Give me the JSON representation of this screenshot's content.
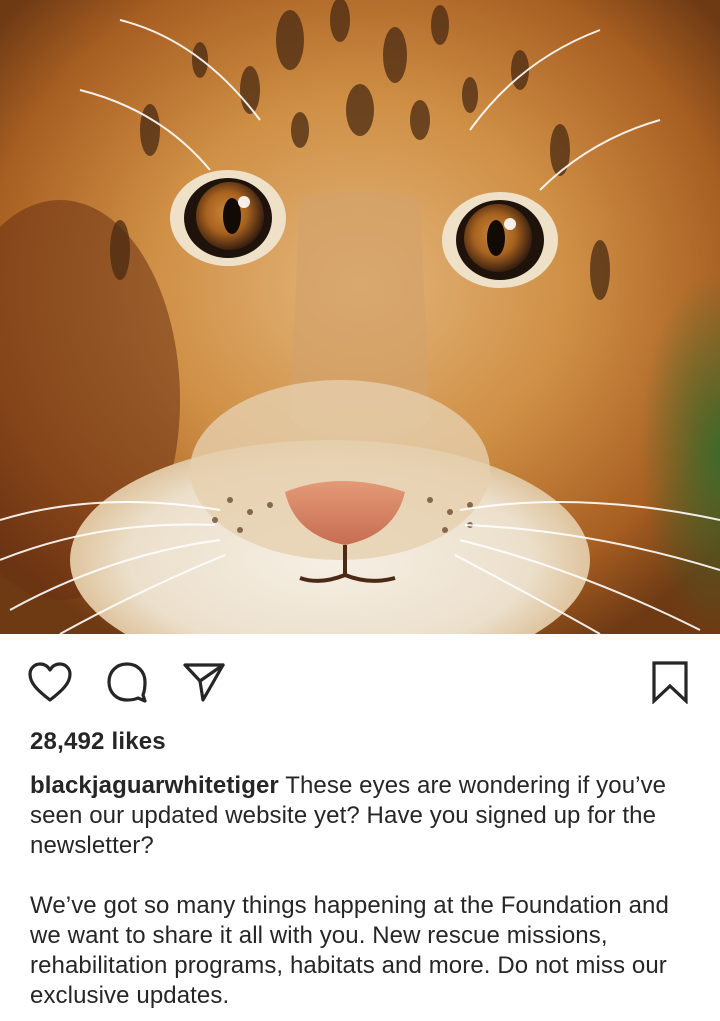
{
  "post": {
    "image_alt": "Close-up of a tiger cub's face",
    "likes_text": "28,492 likes",
    "username": "blackjaguarwhitetiger",
    "caption_first": "These eyes are wondering if you’ve seen our updated website yet? Have you signed up for the newsletter?",
    "caption_second": "We’ve got so many things happening at the Foundation and we want to share it all with you. New rescue missions, rehabilitation programs, habitats and more. Do not miss our exclusive updates."
  },
  "actions": {
    "like_icon": "heart-icon",
    "comment_icon": "comment-icon",
    "share_icon": "paper-plane-icon",
    "save_icon": "bookmark-icon"
  },
  "colors": {
    "text": "#262626",
    "background": "#ffffff",
    "icon_stroke": "#262626"
  }
}
